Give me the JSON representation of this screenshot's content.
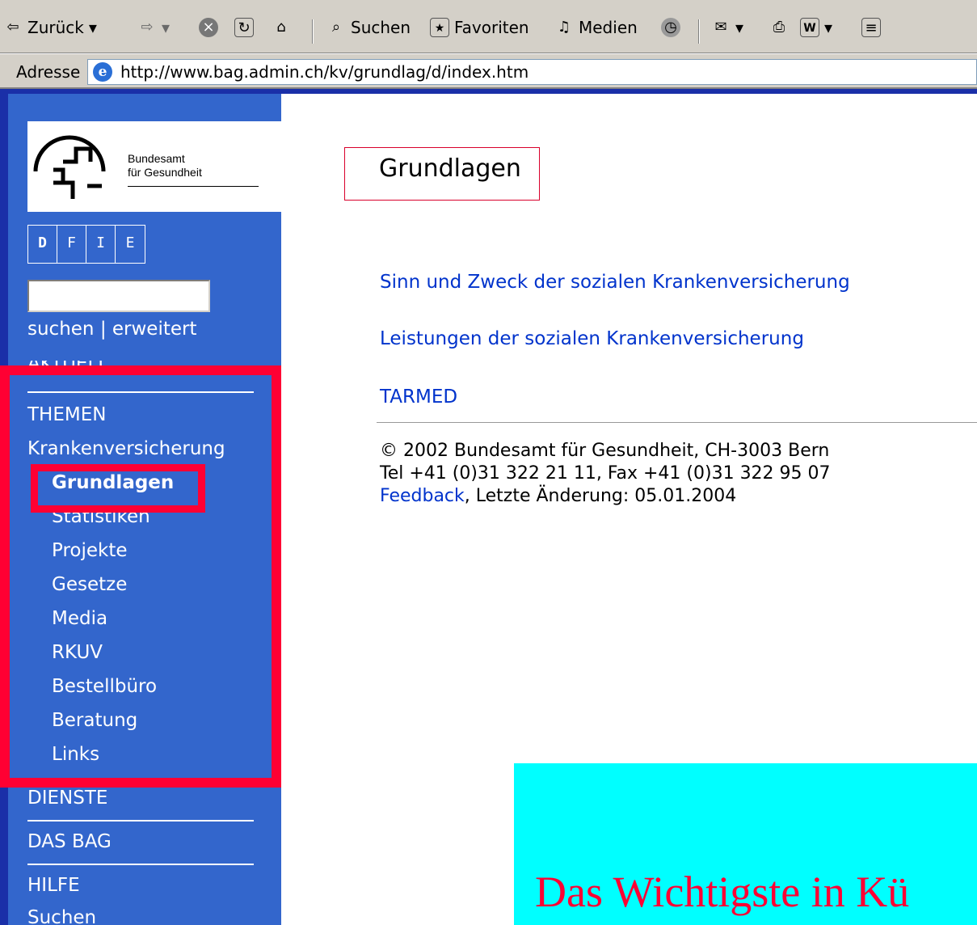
{
  "toolbar": {
    "back_label": "Zurück",
    "search_label": "Suchen",
    "favorites_label": "Favoriten",
    "media_label": "Medien"
  },
  "address_bar": {
    "label": "Adresse",
    "url": "http://www.bag.admin.ch/kv/grundlag/d/index.htm"
  },
  "sidebar": {
    "logo_line1": "Bundesamt",
    "logo_line2": "für Gesundheit",
    "languages": [
      "D",
      "F",
      "I",
      "E"
    ],
    "search_link": "suchen",
    "search_sep": "|",
    "advanced_link": "erweitert",
    "nav": {
      "aktuell": "AKTUELL",
      "themen": "THEMEN",
      "krankenversicherung": "Krankenversicherung",
      "grundlagen": "Grundlagen",
      "statistiken": "Statistiken",
      "projekte": "Projekte",
      "gesetze": "Gesetze",
      "media": "Media",
      "rkuv": "RKUV",
      "bestellbuero": "Bestellbüro",
      "beratung": "Beratung",
      "links": "Links",
      "dienste": "DIENSTE",
      "das_bag": "DAS BAG",
      "hilfe": "HILFE",
      "suchen": "Suchen"
    }
  },
  "main": {
    "title": "Grundlagen",
    "links": [
      "Sinn und Zweck der sozialen Krankenversicherung",
      "Leistungen der sozialen Krankenversicherung",
      "TARMED"
    ],
    "footer_line1": "© 2002 Bundesamt für Gesundheit, CH-3003 Bern",
    "footer_line2": "Tel +41 (0)31 322 21 11, Fax +41 (0)31 322 95 07",
    "footer_feedback": "Feedback",
    "footer_changed": ", Letzte Änderung: 05.01.2004"
  },
  "slide_caption": "Das Wichtigste in Kü",
  "colors": {
    "sidebar_bg": "#3366cc",
    "highlight": "#ff0033",
    "caption_bg": "#00ffff",
    "link": "#0033cc"
  }
}
